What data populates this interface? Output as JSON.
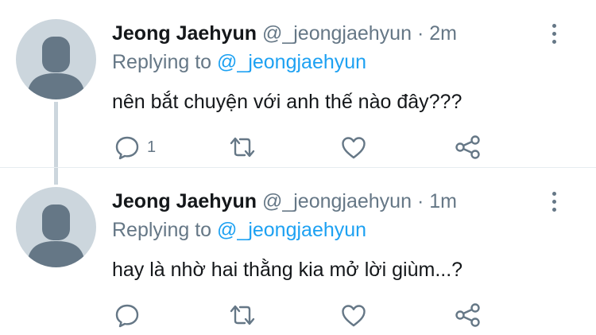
{
  "colors": {
    "name": "#14171a",
    "secondary": "#657786",
    "mention": "#1da1f2",
    "avatar_bg": "#ccd6dd",
    "avatar_fg": "#657786"
  },
  "icons": [
    "avatar-icon",
    "more-vertical-icon",
    "reply-icon",
    "retweet-icon",
    "like-icon",
    "share-icon"
  ],
  "tweets": [
    {
      "name": "Jeong Jaehyun",
      "handle": "@_jeongjaehyun",
      "separator": "·",
      "time": "2m",
      "replying_label": "Replying to",
      "replying_handle": "@_jeongjaehyun",
      "text": "nên bắt chuyện với anh thế nào đây???",
      "reply_count": "1"
    },
    {
      "name": "Jeong Jaehyun",
      "handle": "@_jeongjaehyun",
      "separator": "·",
      "time": "1m",
      "replying_label": "Replying to",
      "replying_handle": "@_jeongjaehyun",
      "text": "hay là nhờ hai thằng kia mở lời giùm...?",
      "reply_count": ""
    }
  ]
}
